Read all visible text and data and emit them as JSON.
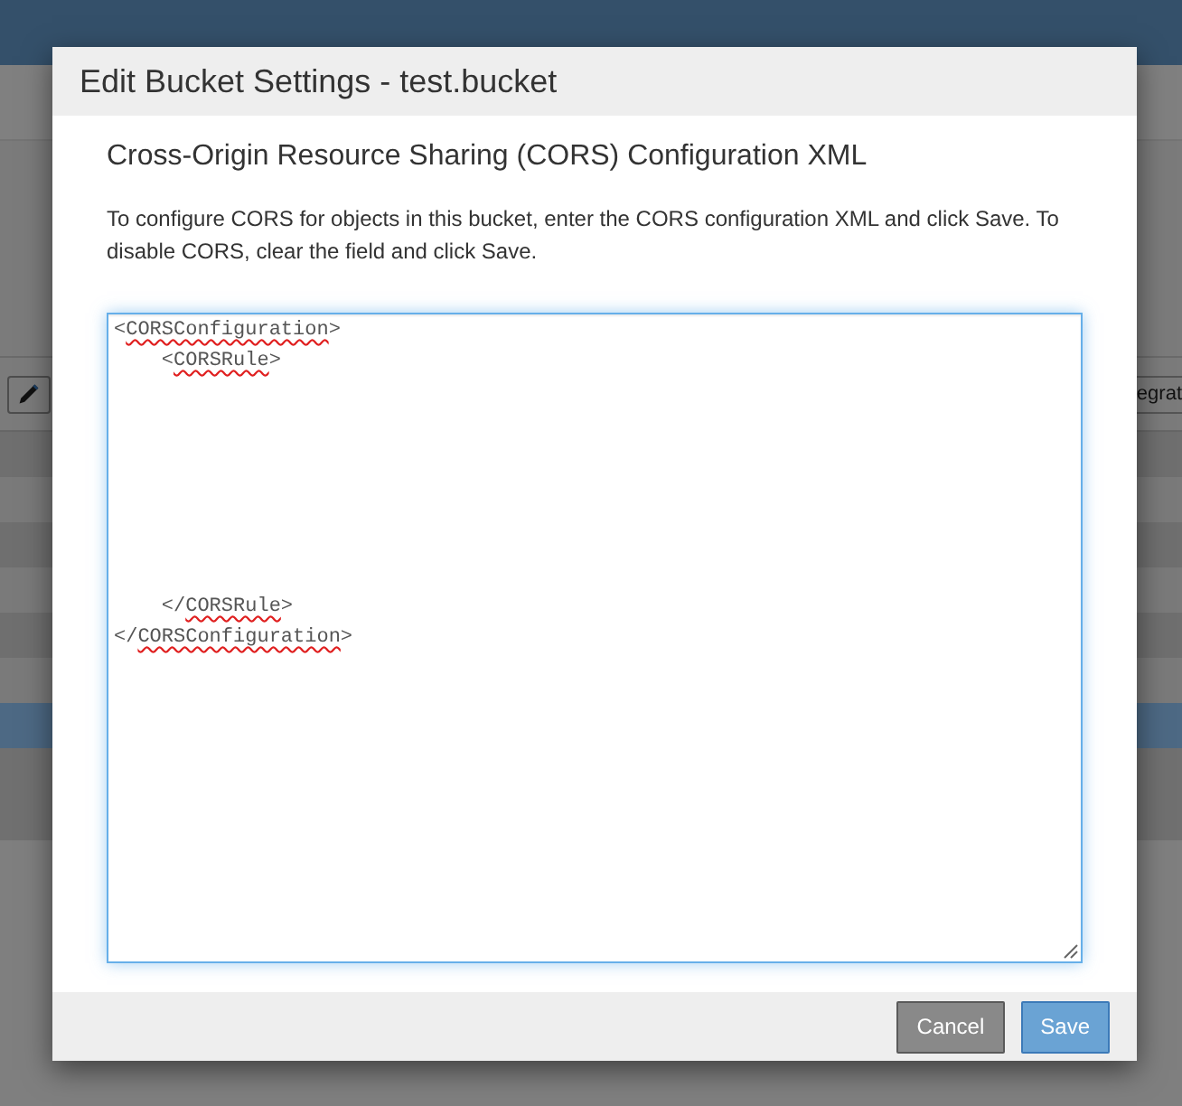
{
  "background": {
    "toolbar": {
      "right_button": {
        "label": "egrat"
      }
    },
    "table": {
      "rows": [
        {
          "selected": false
        },
        {
          "selected": false
        },
        {
          "selected": false
        },
        {
          "selected": false
        },
        {
          "selected": false
        },
        {
          "selected": false
        },
        {
          "selected": true
        }
      ]
    }
  },
  "dialog": {
    "title": "Edit Bucket Settings - test.bucket",
    "heading": "Cross-Origin Resource Sharing (CORS) Configuration XML",
    "description": "To configure CORS for objects in this bucket, enter the CORS configuration XML and click Save. To disable CORS, clear the field and click Save.",
    "xml_field": {
      "value": "<CORSConfiguration>\n    <CORSRule>\n\n\n\n\n\n\n\n    </CORSRule>\n</CORSConfiguration>"
    },
    "buttons": [
      {
        "label": "Cancel",
        "kind": "secondary"
      },
      {
        "label": "Save",
        "kind": "primary"
      }
    ]
  }
}
